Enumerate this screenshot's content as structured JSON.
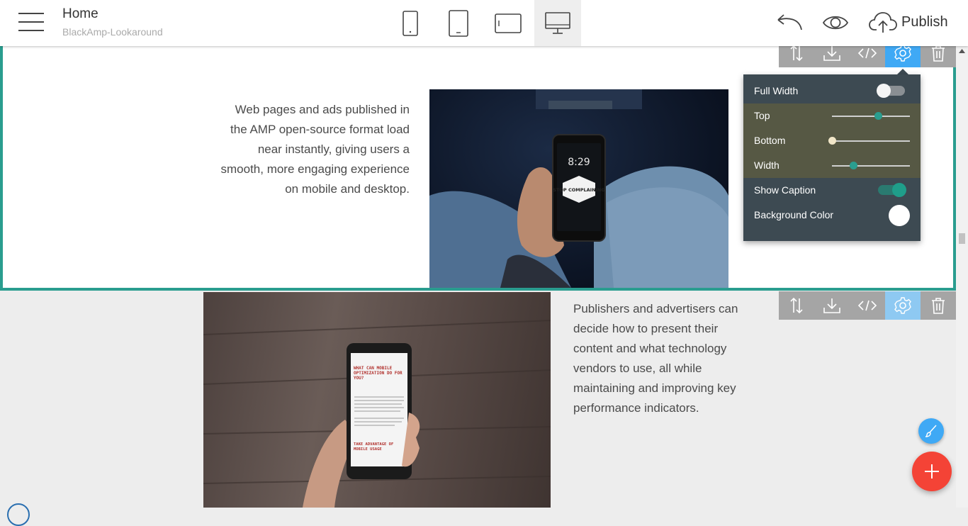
{
  "header": {
    "title": "Home",
    "subtitle": "BlackAmp-Lookaround",
    "publish_label": "Publish",
    "devices": [
      "phone-icon",
      "tablet-icon",
      "tablet-landscape-icon",
      "desktop-icon"
    ],
    "active_device": "desktop"
  },
  "section1": {
    "text": "Web pages and ads published in the AMP open-source format load near instantly, giving users a smooth, more engaging experience on mobile and desktop.",
    "phone_time": "8:29",
    "phone_badge": "STOP COMPLAINING"
  },
  "section2": {
    "text": "Publishers and advertisers can decide how to present their content and what technology vendors to use, all while maintaining and improving key performance indicators.",
    "phone_heading": "WHAT CAN MOBILE OPTIMIZATION DO FOR YOU?",
    "phone_subheading": "TAKE ADVANTAGE OF MOBILE USAGE"
  },
  "settings_panel": {
    "full_width_label": "Full Width",
    "full_width_on": false,
    "top_label": "Top",
    "top_value": 0.6,
    "bottom_label": "Bottom",
    "bottom_value": 0.0,
    "width_label": "Width",
    "width_value": 0.3,
    "show_caption_label": "Show Caption",
    "show_caption_on": true,
    "background_color_label": "Background Color",
    "background_color": "#ffffff"
  },
  "colors": {
    "accent": "#2a9d8f",
    "toolbar_active": "#3fa9f5",
    "fab_add": "#f44336",
    "panel_bg": "#3d4a52"
  }
}
